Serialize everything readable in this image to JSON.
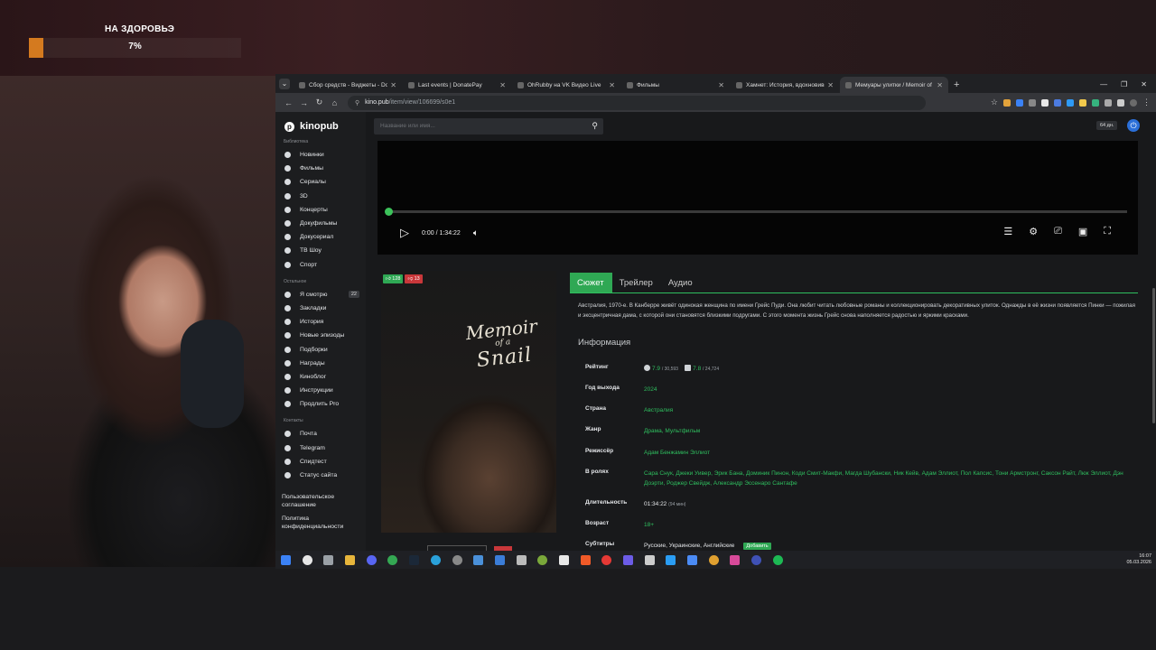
{
  "overlay": {
    "goal_title": "НА ЗДОРОВЬЭ",
    "goal_percent_label": "7%",
    "goal_percent": 7,
    "goal_color": "#d47a1f"
  },
  "browser": {
    "tabs": [
      {
        "title": "Сбор средств - Виджеты - Do",
        "icon": "donation-icon",
        "active": false
      },
      {
        "title": "Last events | DonatePay",
        "icon": "donatepay-icon",
        "active": false
      },
      {
        "title": "OhRubby на VK Видео Live",
        "icon": "vk-icon",
        "active": false
      },
      {
        "title": "Фильмы",
        "icon": "kinopub-icon",
        "active": false
      },
      {
        "title": "Хамнет: История, вдохновивш",
        "icon": "kinopub-icon",
        "active": false
      },
      {
        "title": "Мемуары улитки / Memoir of",
        "icon": "kinopub-icon",
        "active": true
      }
    ],
    "url_host": "kino.pub",
    "url_path": "/item/view/106699/s0e1"
  },
  "site": {
    "logo": "kinopub",
    "search_placeholder": "Название или имя...",
    "resolution_badge": "64 дн.",
    "accent": "#2fa854",
    "sidebar": {
      "library_heading": "Библиотека",
      "library": [
        {
          "label": "Новинки",
          "icon": "new-icon"
        },
        {
          "label": "Фильмы",
          "icon": "film-icon"
        },
        {
          "label": "Сериалы",
          "icon": "tv-icon"
        },
        {
          "label": "3D",
          "icon": "3d-icon"
        },
        {
          "label": "Концерты",
          "icon": "concert-icon"
        },
        {
          "label": "Докуфильмы",
          "icon": "doc-icon"
        },
        {
          "label": "Докусериал",
          "icon": "doc-series-icon"
        },
        {
          "label": "ТВ Шоу",
          "icon": "tv-show-icon"
        },
        {
          "label": "Спорт",
          "icon": "sport-icon"
        }
      ],
      "other_heading": "Остальное",
      "other": [
        {
          "label": "Я смотрю",
          "icon": "watching-icon",
          "badge": "22"
        },
        {
          "label": "Закладки",
          "icon": "bookmark-icon"
        },
        {
          "label": "История",
          "icon": "history-icon"
        },
        {
          "label": "Новые эпизоды",
          "icon": "new-episodes-icon"
        },
        {
          "label": "Подборки",
          "icon": "collections-icon"
        },
        {
          "label": "Награды",
          "icon": "award-icon"
        },
        {
          "label": "Киноблог",
          "icon": "blog-icon"
        },
        {
          "label": "Инструкции",
          "icon": "instructions-icon"
        },
        {
          "label": "Продлить Pro",
          "icon": "pro-icon"
        }
      ],
      "contacts_heading": "Контакты",
      "contacts": [
        {
          "label": "Почта",
          "icon": "mail-icon"
        },
        {
          "label": "Telegram",
          "icon": "telegram-icon"
        },
        {
          "label": "Спидтест",
          "icon": "speedtest-icon"
        },
        {
          "label": "Статус сайта",
          "icon": "status-icon"
        }
      ],
      "footer_links": [
        "Пользовательское соглашение",
        "Политика конфиденциальности"
      ]
    },
    "player": {
      "time": "0:00 / 1:34:22",
      "progress": 0
    },
    "poster": {
      "title_line1": "Memoir",
      "title_line2": "of a",
      "title_line3": "Snail",
      "likes": "128",
      "dislikes": "13"
    },
    "content_tabs": [
      "Сюжет",
      "Трейлер",
      "Аудио"
    ],
    "plot": "Австралия, 1970-е. В Канберре живёт одинокая женщина по имени Грейс Пуди. Она любит читать любовные романы и коллекционировать декоративных улиток. Однажды в её жизни появляется Пинки — пожилая и эксцентричная дама, с которой они становятся близкими подругами. С этого момента жизнь Грейс снова наполняется радостью и яркими красками.",
    "info_heading": "Информация",
    "info": {
      "rating_label": "Рейтинг",
      "rating_kp": "7.9",
      "rating_kp_votes": "/ 30,593",
      "rating_imdb": "7.8",
      "rating_imdb_votes": "/ 24,724",
      "year_label": "Год выхода",
      "year": "2024",
      "country_label": "Страна",
      "country": "Австралия",
      "genre_label": "Жанр",
      "genre": "Драма, Мультфильм",
      "director_label": "Режиссёр",
      "director": "Адам Бенжамин Эллиот",
      "cast_label": "В ролях",
      "cast": "Сара Снук, Джеки Уивер, Эрик Бана, Доминик Пинон, Коди Смит-Макфи, Магда Шубански, Ник Кейв, Адам Эллиот, Пол Капсис, Тони Армстронг, Саксон Райт, Люк Эллиот, Дэн Доэрти, Роджер Свейдж, Александр Эссенаро Сантафе",
      "duration_label": "Длительность",
      "duration": "01:34:22",
      "duration_minutes": "(94 мин)",
      "age_label": "Возраст",
      "age": "18+",
      "subs_label": "Субтитры",
      "subs": "Русские, Украинские, Английские",
      "subs_add": "Добавить"
    }
  },
  "taskbar": {
    "time": "16:07",
    "date": "05.03.2026"
  }
}
